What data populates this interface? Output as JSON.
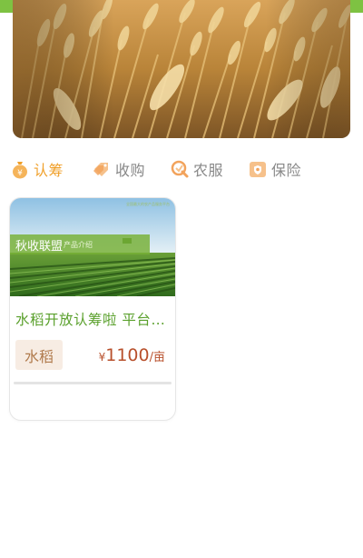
{
  "banner": {
    "image": "wheat-field-banner"
  },
  "tabs": [
    {
      "label": "认筹",
      "icon": "money-bag-icon",
      "active": true
    },
    {
      "label": "收购",
      "icon": "tag-icon",
      "active": false
    },
    {
      "label": "农服",
      "icon": "service-icon",
      "active": false
    },
    {
      "label": "保险",
      "icon": "shield-icon",
      "active": false
    }
  ],
  "product": {
    "image_overlay_title": "秋收联盟",
    "image_overlay_subtitle": "产品介绍",
    "image_tiny_text": "全国最大的农产品服务平台",
    "title": "水稻开放认筹啦 平台…",
    "crop_tag": "水稻",
    "price_currency": "¥",
    "price_amount": "1100",
    "price_unit": "/亩",
    "progress": 0
  },
  "colors": {
    "accent_green": "#7ec242",
    "active_tab": "#f0a02a",
    "inactive_tab": "#888888",
    "price": "#b8502c",
    "title_green": "#5aa02c",
    "tag_bg": "#f7ece3"
  }
}
